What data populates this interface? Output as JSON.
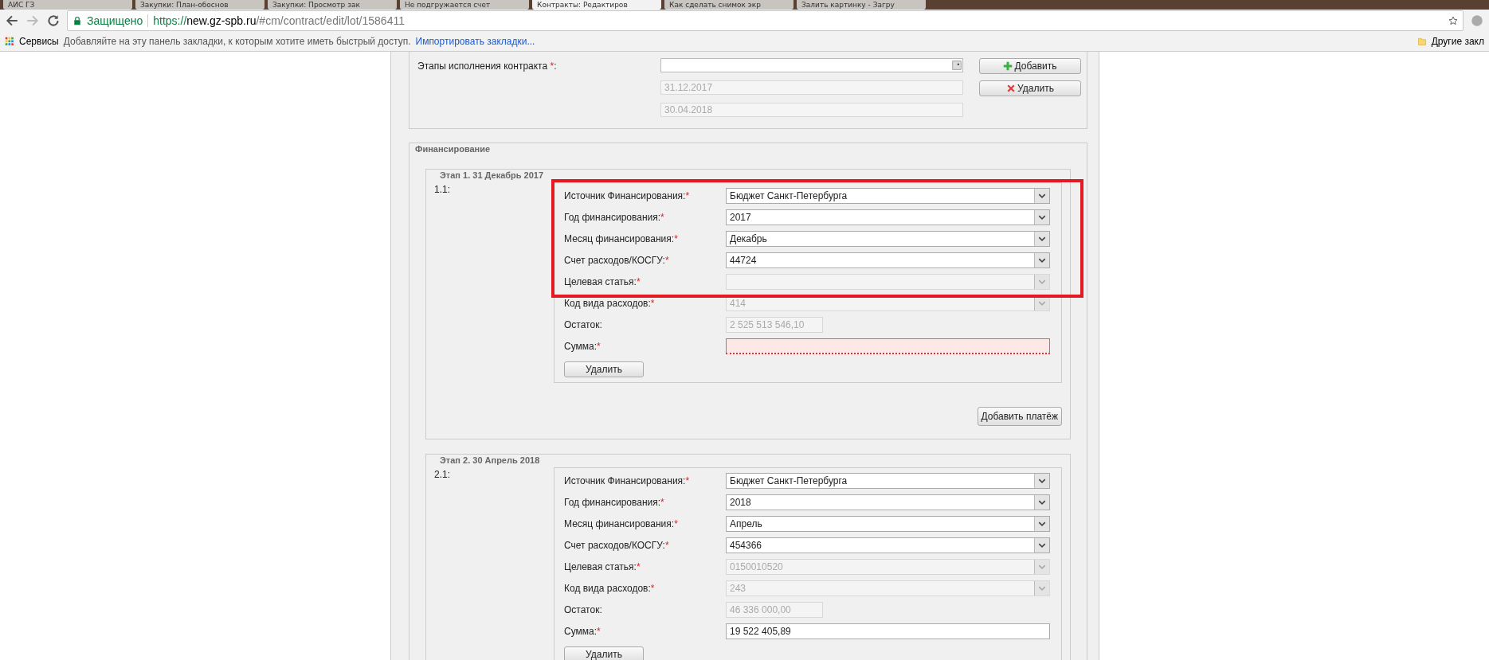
{
  "browser": {
    "tabs": [
      {
        "title": "АИС ГЗ",
        "selected": false
      },
      {
        "title": "Закупки: План-обоснов",
        "selected": false
      },
      {
        "title": "Закупки: Просмотр зак",
        "selected": false
      },
      {
        "title": "Не подгружается счет",
        "selected": false
      },
      {
        "title": "Контракты: Редактиров",
        "selected": true
      },
      {
        "title": "Как сделать снимок экр",
        "selected": false
      },
      {
        "title": "Залить картинку - Загру",
        "selected": false
      }
    ],
    "secure_label": "Защищено",
    "url": {
      "scheme": "https://",
      "host": "new.gz-spb.ru",
      "path": "/#cm/contract/edit/lot/1586411"
    },
    "bookmarks": {
      "apps": "Сервисы",
      "hint": "Добавляйте на эту панель закладки, к которым хотите иметь быстрый доступ.",
      "import_link": "Импортировать закладки...",
      "other": "Другие закл"
    }
  },
  "contract_stages": {
    "label": "Этапы исполнения контракта",
    "required_mark": "*",
    "suffix": ":",
    "dates": [
      "31.12.2017",
      "30.04.2018"
    ],
    "buttons": [
      {
        "kind": "add",
        "label": "Добавить"
      },
      {
        "kind": "delete",
        "label": "Удалить"
      }
    ]
  },
  "financing": {
    "legend": "Финансирование",
    "stages": [
      {
        "legend": "Этап 1. 31 Декабрь 2017",
        "highlighted": true,
        "add_payment": "Добавить платёж",
        "payments": [
          {
            "number": "1.1:",
            "delete": "Удалить",
            "fields": [
              {
                "kind": "select",
                "label": "Источник Финансирования:",
                "required": true,
                "value": "Бюджет Санкт-Петербурга",
                "disabled": false
              },
              {
                "kind": "select",
                "label": "Год финансирования:",
                "required": true,
                "value": "2017",
                "disabled": false
              },
              {
                "kind": "select",
                "label": "Месяц финансирования:",
                "required": true,
                "value": "Декабрь",
                "disabled": false
              },
              {
                "kind": "select",
                "label": "Счет расходов/КОСГУ:",
                "required": true,
                "value": "44724",
                "disabled": false
              },
              {
                "kind": "select",
                "label": "Целевая статья:",
                "required": true,
                "disabled": true
              },
              {
                "kind": "select",
                "label": "Код вида расходов:",
                "required": true,
                "value": "414",
                "disabled": true
              },
              {
                "kind": "readout",
                "label": "Остаток:",
                "value": "2 525 513 546,10",
                "disabled": true
              },
              {
                "kind": "input",
                "label": "Сумма:",
                "required": true,
                "invalid": true
              }
            ]
          }
        ]
      },
      {
        "legend": "Этап 2. 30 Апрель 2018",
        "payments": [
          {
            "number": "2.1:",
            "delete": "Удалить",
            "fields": [
              {
                "kind": "select",
                "label": "Источник Финансирования:",
                "required": true,
                "value": "Бюджет Санкт-Петербурга",
                "disabled": false
              },
              {
                "kind": "select",
                "label": "Год финансирования:",
                "required": true,
                "value": "2018",
                "disabled": false
              },
              {
                "kind": "select",
                "label": "Месяц финансирования:",
                "required": true,
                "value": "Апрель",
                "disabled": false
              },
              {
                "kind": "select",
                "label": "Счет расходов/КОСГУ:",
                "required": true,
                "value": "454366",
                "disabled": false
              },
              {
                "kind": "select",
                "label": "Целевая статья:",
                "required": true,
                "value": "0150010520",
                "disabled": true
              },
              {
                "kind": "select",
                "label": "Код вида расходов:",
                "required": true,
                "value": "243",
                "disabled": true
              },
              {
                "kind": "readout",
                "label": "Остаток:",
                "value": "46 336 000,00",
                "disabled": true
              },
              {
                "kind": "input",
                "label": "Сумма:",
                "required": true,
                "value": "19 522 405,89",
                "invalid": false
              }
            ]
          }
        ]
      }
    ]
  }
}
